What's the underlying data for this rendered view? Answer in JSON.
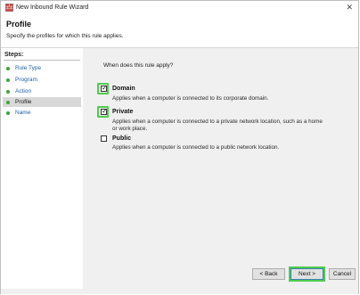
{
  "window": {
    "title": "New Inbound Rule Wizard",
    "close_glyph": "✕"
  },
  "header": {
    "title": "Profile",
    "subtitle": "Specify the profiles for which this rule applies."
  },
  "steps": {
    "title": "Steps:",
    "items": [
      {
        "label": "Rule Type",
        "active": false
      },
      {
        "label": "Program",
        "active": false
      },
      {
        "label": "Action",
        "active": false
      },
      {
        "label": "Profile",
        "active": true
      },
      {
        "label": "Name",
        "active": false
      }
    ]
  },
  "content": {
    "question": "When does this rule apply?",
    "options": [
      {
        "label": "Domain",
        "checked": true,
        "description": [
          "Applies when a computer is connected to its corporate domain."
        ]
      },
      {
        "label": "Private",
        "checked": true,
        "description": [
          "Applies when a computer is connected to a private network location, such as a home",
          "or work place."
        ]
      },
      {
        "label": "Public",
        "checked": false,
        "description": [
          "Applies when a computer is connected to a public network location."
        ]
      }
    ]
  },
  "buttons": {
    "back": "< Back",
    "next": "Next >",
    "cancel": "Cancel"
  },
  "colors": {
    "highlight": "#4fcc4f",
    "step_dot": "#3aa63a",
    "link": "#1f5fa6"
  }
}
